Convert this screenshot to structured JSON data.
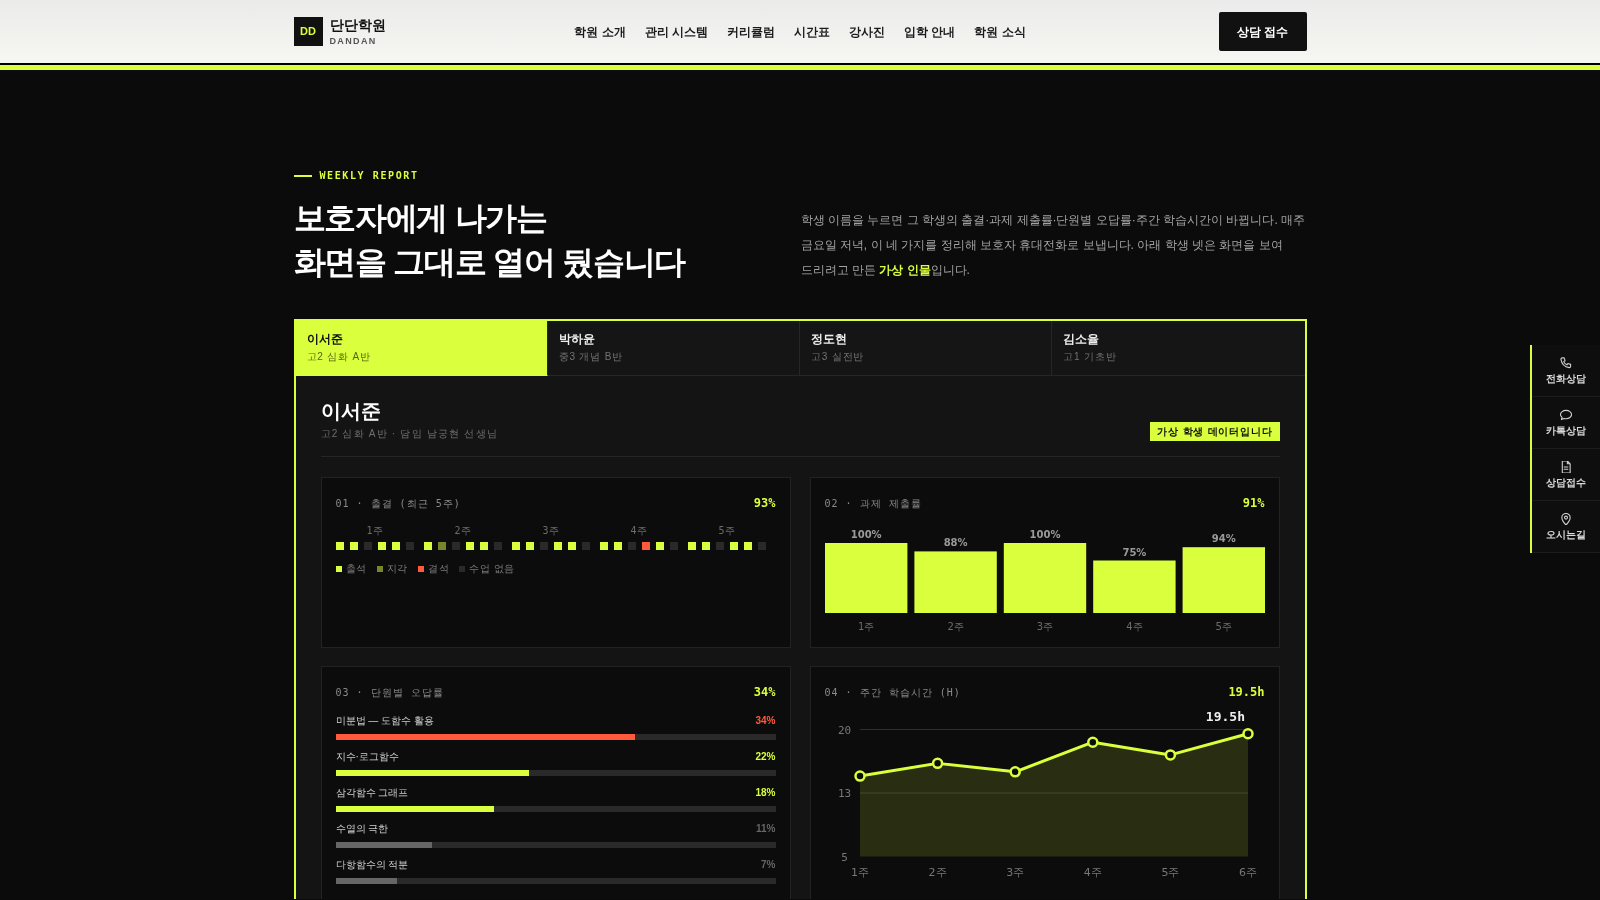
{
  "header": {
    "logo_mark": "DD",
    "logo_name": "단단학원",
    "logo_sub": "DANDAN",
    "nav": [
      "학원 소개",
      "관리 시스템",
      "커리큘럼",
      "시간표",
      "강사진",
      "입학 안내",
      "학원 소식"
    ],
    "cta": "상담 접수"
  },
  "intro": {
    "eyebrow": "WEEKLY REPORT",
    "title": "보호자에게 나가는\n화면을 그대로 열어 뒀습니다",
    "description": "학생 이름을 누르면 그 학생의 출결·과제 제출률·단원별 오답률·주간 학습시간이 바뀝니다. 매주 금요일 저녁, 이 네 가지를 정리해 보호자 휴대전화로 보냅니다. 아래 학생 넷은 화면을 보여 드리려고 만든 **가상 인물**입니다."
  },
  "student_tabs": [
    {
      "name": "이서준",
      "class": "고2 심화 A반",
      "selected": true
    },
    {
      "name": "박하윤",
      "class": "중3 개념 B반",
      "selected": false
    },
    {
      "name": "정도현",
      "class": "고3 실전반",
      "selected": false
    },
    {
      "name": "김소율",
      "class": "고1 기초반",
      "selected": false
    }
  ],
  "student": {
    "name": "이서준",
    "meta": "고2 심화 A반 · 담임 남궁현 선생님",
    "badge": "가상 학생 데이터입니다"
  },
  "cards": [
    {
      "kind": "attendance",
      "title": "01 · 출결 (최근 5주)",
      "value": "93%",
      "weeks": [
        {
          "label": "1주",
          "days": [
            {
              "kind": "present"
            },
            {
              "kind": "present"
            },
            {
              "kind": "off"
            },
            {
              "kind": "present"
            },
            {
              "kind": "present"
            },
            {
              "kind": "off"
            }
          ]
        },
        {
          "label": "2주",
          "days": [
            {
              "kind": "present"
            },
            {
              "kind": "late"
            },
            {
              "kind": "off"
            },
            {
              "kind": "present"
            },
            {
              "kind": "present"
            },
            {
              "kind": "off"
            }
          ]
        },
        {
          "label": "3주",
          "days": [
            {
              "kind": "present"
            },
            {
              "kind": "present"
            },
            {
              "kind": "off"
            },
            {
              "kind": "present"
            },
            {
              "kind": "present"
            },
            {
              "kind": "off"
            }
          ]
        },
        {
          "label": "4주",
          "days": [
            {
              "kind": "present"
            },
            {
              "kind": "present"
            },
            {
              "kind": "off"
            },
            {
              "kind": "absent"
            },
            {
              "kind": "present"
            },
            {
              "kind": "off"
            }
          ]
        },
        {
          "label": "5주",
          "days": [
            {
              "kind": "present"
            },
            {
              "kind": "present"
            },
            {
              "kind": "off"
            },
            {
              "kind": "present"
            },
            {
              "kind": "present"
            },
            {
              "kind": "off"
            }
          ]
        }
      ],
      "legend": [
        {
          "kind": "present",
          "label": "출석"
        },
        {
          "kind": "late",
          "label": "지각"
        },
        {
          "kind": "absent",
          "label": "결석"
        },
        {
          "kind": "off",
          "label": "수업 없음"
        }
      ]
    },
    {
      "kind": "chart",
      "title": "02 · 과제 제출률",
      "value": "91%",
      "chart_data": {
        "type": "bar",
        "categories": [
          "1주",
          "2주",
          "3주",
          "4주",
          "5주"
        ],
        "values": [
          100,
          88,
          100,
          75,
          94
        ],
        "ylim": [
          0,
          100
        ],
        "value_labels": [
          "100%",
          "88%",
          "100%",
          "75%",
          "94%"
        ]
      }
    },
    {
      "kind": "error_rates",
      "title": "03 · 단원별 오답률",
      "value": "34%",
      "items": [
        {
          "label": "미분법 — 도함수 활용",
          "reading": "34%",
          "level": 0.68,
          "color": "#ff5a3c"
        },
        {
          "label": "지수·로그함수",
          "reading": "22%",
          "level": 0.44,
          "color": "#d9ff3d"
        },
        {
          "label": "삼각함수 그래프",
          "reading": "18%",
          "level": 0.36,
          "color": "#d9ff3d"
        },
        {
          "label": "수열의 극한",
          "reading": "11%",
          "level": 0.22,
          "color": "#666666"
        },
        {
          "label": "다항함수의 적분",
          "reading": "7%",
          "level": 0.14,
          "color": "#666666"
        }
      ]
    },
    {
      "kind": "chart",
      "title": "04 · 주간 학습시간 (H)",
      "value": "19.5h",
      "chart_data": {
        "type": "area",
        "x": [
          "1주",
          "2주",
          "3주",
          "4주",
          "5주",
          "6주"
        ],
        "series": [
          {
            "color": "#d9ff3d",
            "values": [
              14.5,
              16,
              15,
              18.5,
              17,
              19.5
            ]
          }
        ],
        "ylim": [
          5,
          20
        ],
        "yticks": [
          {
            "value": 5,
            "label": "5"
          },
          {
            "value": 12.5,
            "label": "13"
          },
          {
            "value": 20,
            "label": "20"
          }
        ],
        "annotations": [
          {
            "x": "6주",
            "y": 19.5,
            "text": "19.5h"
          }
        ]
      }
    }
  ],
  "quick_menu": [
    "전화상담",
    "카톡상담",
    "상담접수",
    "오시는길"
  ]
}
